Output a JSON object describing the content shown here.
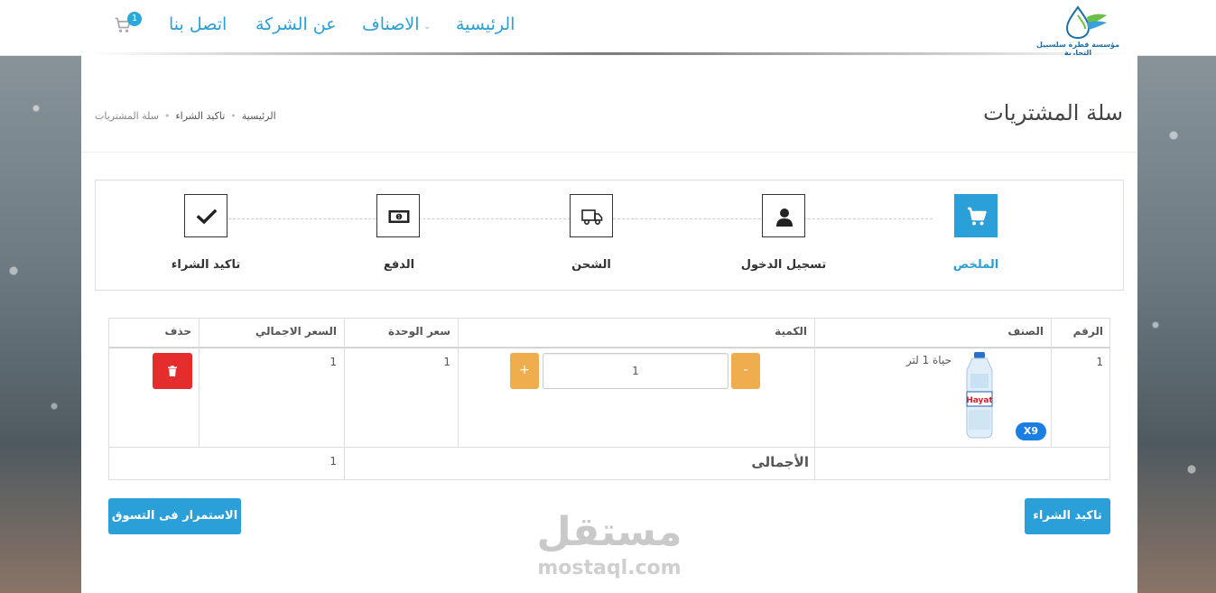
{
  "header": {
    "logo_text": "مؤسسة قطرة سلسبيل التجارية",
    "nav": {
      "home": "الرئيسية",
      "categories": "الاصناف",
      "about": "عن الشركة",
      "contact": "اتصل بنا"
    },
    "cart_count": "1"
  },
  "page": {
    "title": "سلة المشتريات",
    "breadcrumb": [
      "الرئيسية",
      "تاكيد الشراء",
      "سلة المشتريات"
    ]
  },
  "steps": [
    {
      "label": "الملخص",
      "icon": "cart-icon",
      "active": true
    },
    {
      "label": "تسجيل الدخول",
      "icon": "user-icon",
      "active": false
    },
    {
      "label": "الشحن",
      "icon": "truck-icon",
      "active": false
    },
    {
      "label": "الدفع",
      "icon": "money-icon",
      "active": false
    },
    {
      "label": "تاكيد الشراء",
      "icon": "check-icon",
      "active": false
    }
  ],
  "table": {
    "headers": {
      "number": "الرقم",
      "item": "الصنف",
      "quantity": "الكمية",
      "unit_price": "سعر الوحدة",
      "total_price": "السعر الاجمالي",
      "delete": "حذف"
    },
    "rows": [
      {
        "number": "1",
        "item": "حياة 1 لتر",
        "quantity": "1",
        "unit_price": "1",
        "total_price": "1",
        "badge": "X9",
        "product_brand": "Hayat"
      }
    ],
    "total_label": "الأجمالى",
    "total_value": "1",
    "minus_label": "-",
    "plus_label": "+"
  },
  "actions": {
    "confirm": "تاكيد الشراء",
    "continue": "الاستمرار فى التسوق"
  },
  "watermark": {
    "main": "مستقل",
    "sub": "mostaql.com"
  },
  "colors": {
    "accent": "#2a9fd8",
    "warning": "#f0ad4e",
    "danger": "#e52d2d",
    "badge": "#1a7fe0"
  }
}
